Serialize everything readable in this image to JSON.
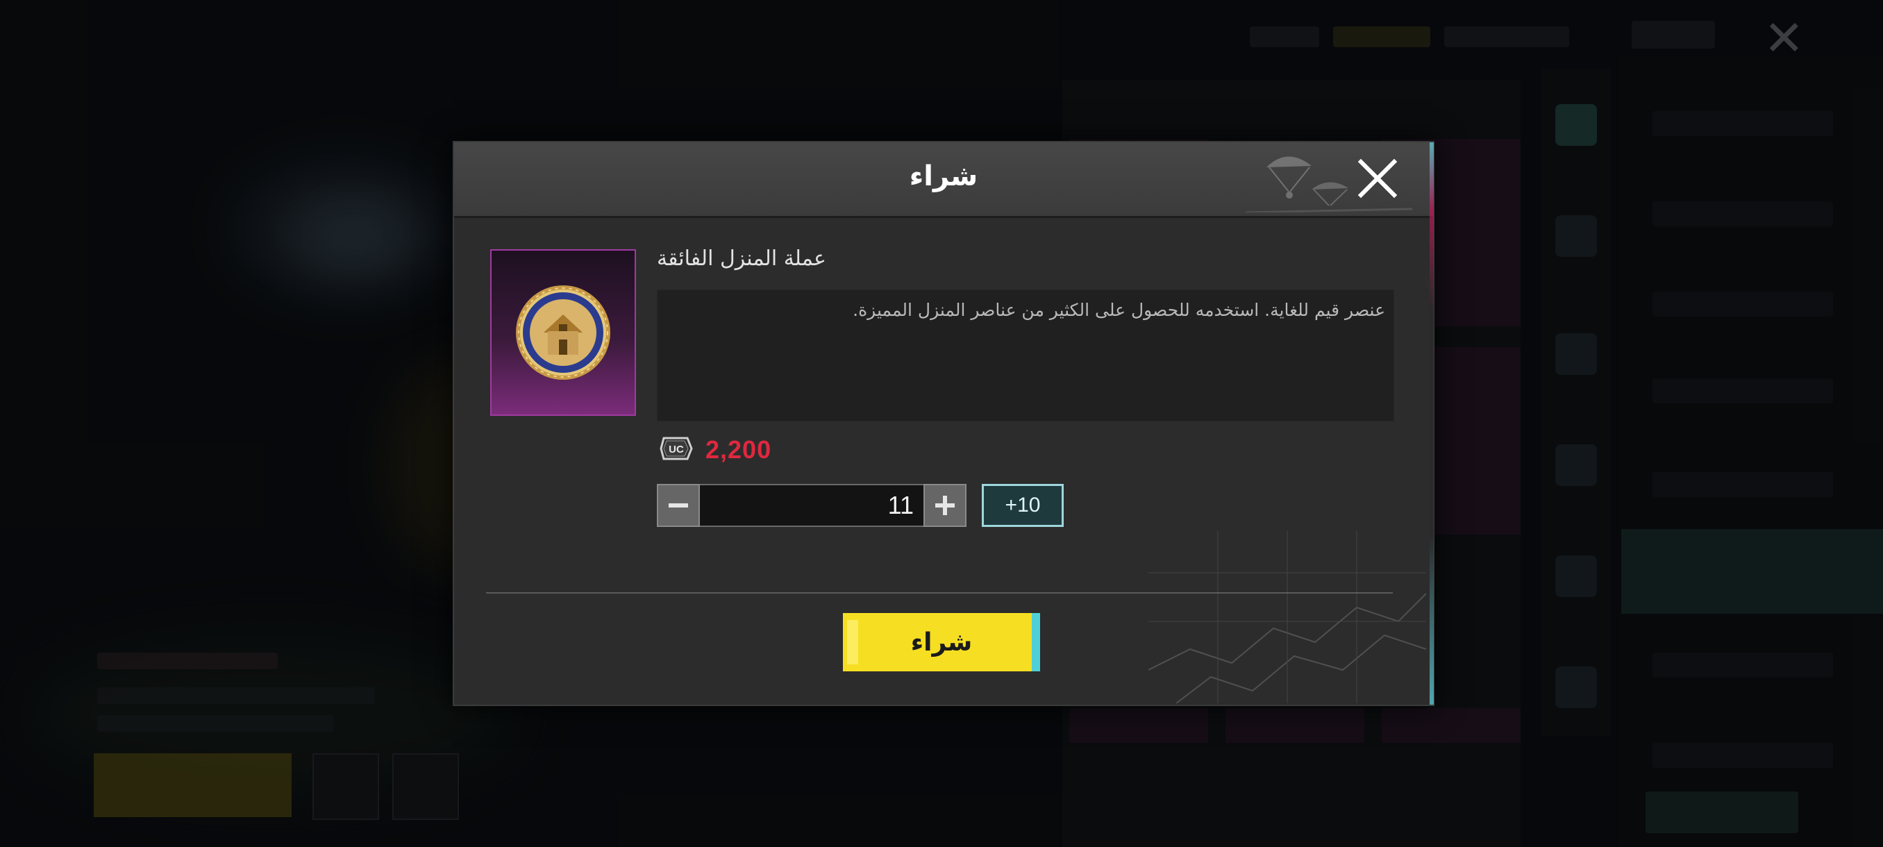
{
  "dialog": {
    "title": "شراء",
    "close_icon": "close-icon"
  },
  "item": {
    "name": "عملة المنزل الفائقة",
    "description": "عنصر قيم للغاية. استخدمه للحصول على الكثير من عناصر المنزل المميزة.",
    "icon": "house-coin-icon",
    "rarity_color": "#a03aa0"
  },
  "price": {
    "currency_icon": "uc-icon",
    "currency_label": "UC",
    "amount": "2,200",
    "color": "#e0283f"
  },
  "quantity": {
    "value": "11",
    "decrement_icon": "minus-icon",
    "increment_icon": "plus-icon",
    "quick_add_label": "+10"
  },
  "actions": {
    "buy_label": "شراء",
    "buy_color": "#f6de22"
  }
}
